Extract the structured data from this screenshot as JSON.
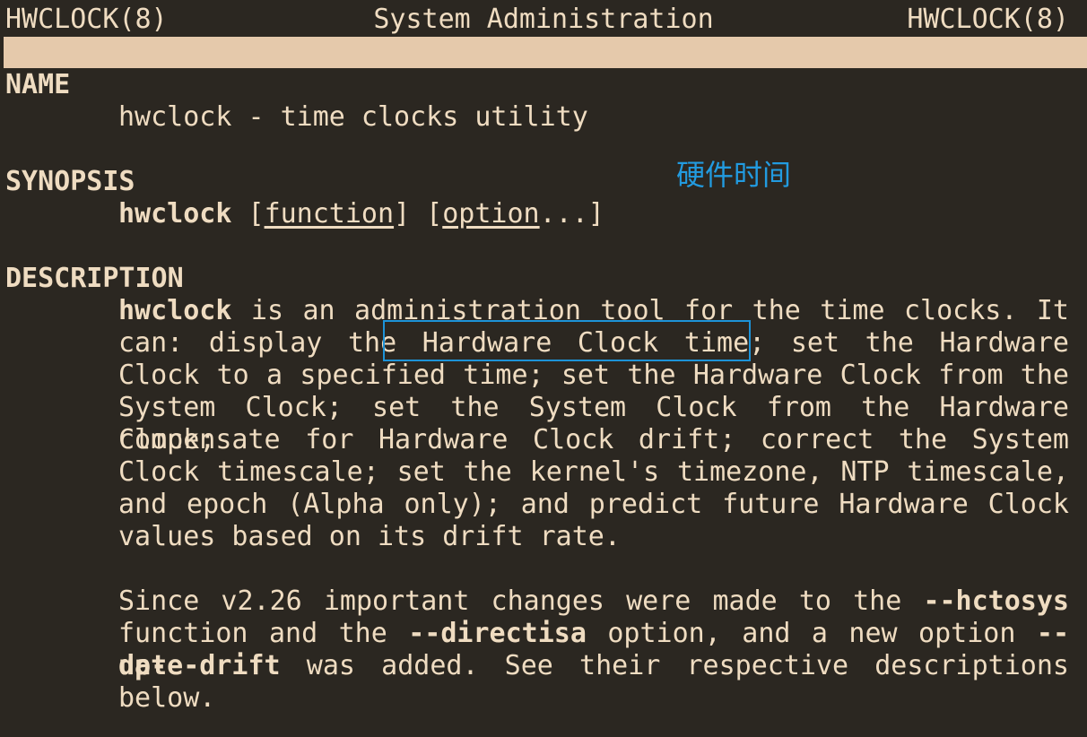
{
  "header": {
    "left": "HWCLOCK(8)",
    "center": "System Administration",
    "right": "HWCLOCK(8)"
  },
  "sections": {
    "name_heading": "NAME",
    "name_text": "hwclock - time clocks utility",
    "synopsis_heading": "SYNOPSIS",
    "synopsis": {
      "command": "hwclock",
      "function_open": " [",
      "function": "function",
      "function_close": "] [",
      "option": "option",
      "option_close": "...]"
    },
    "description_heading": "DESCRIPTION"
  },
  "description": {
    "p1": {
      "l1_cmd": "hwclock",
      "l1_rest": "  is an administration tool for the time clocks.  It",
      "l2": "can: display the Hardware Clock time; set the Hardware",
      "l3": "Clock to a specified time; set the Hardware Clock from the",
      "l4": "System Clock; set the System Clock from the Hardware Clock;",
      "l5": "compensate for Hardware Clock drift; correct the System",
      "l6": "Clock timescale; set the kernel's timezone, NTP timescale,",
      "l7": "and epoch (Alpha only); and predict future Hardware Clock",
      "l8": "values based on its drift rate."
    },
    "p2": {
      "l1_text": "Since v2.26 important changes were made to the ",
      "l1_opt": "--hctosys",
      "l2_a": "function and the ",
      "l2_opt": "--directisa",
      "l2_b": " option, and a new option ",
      "l2_opt2": "--up-",
      "l3_opt": "date-drift",
      "l3_rest": " was added.  See their respective descriptions",
      "l4": "below."
    }
  },
  "annotation": {
    "text": "硬件时间",
    "color": "#1d93d8"
  },
  "colors": {
    "background": "#2b2721",
    "text": "#efdcc1",
    "status_bar": "#e5c9ab"
  }
}
